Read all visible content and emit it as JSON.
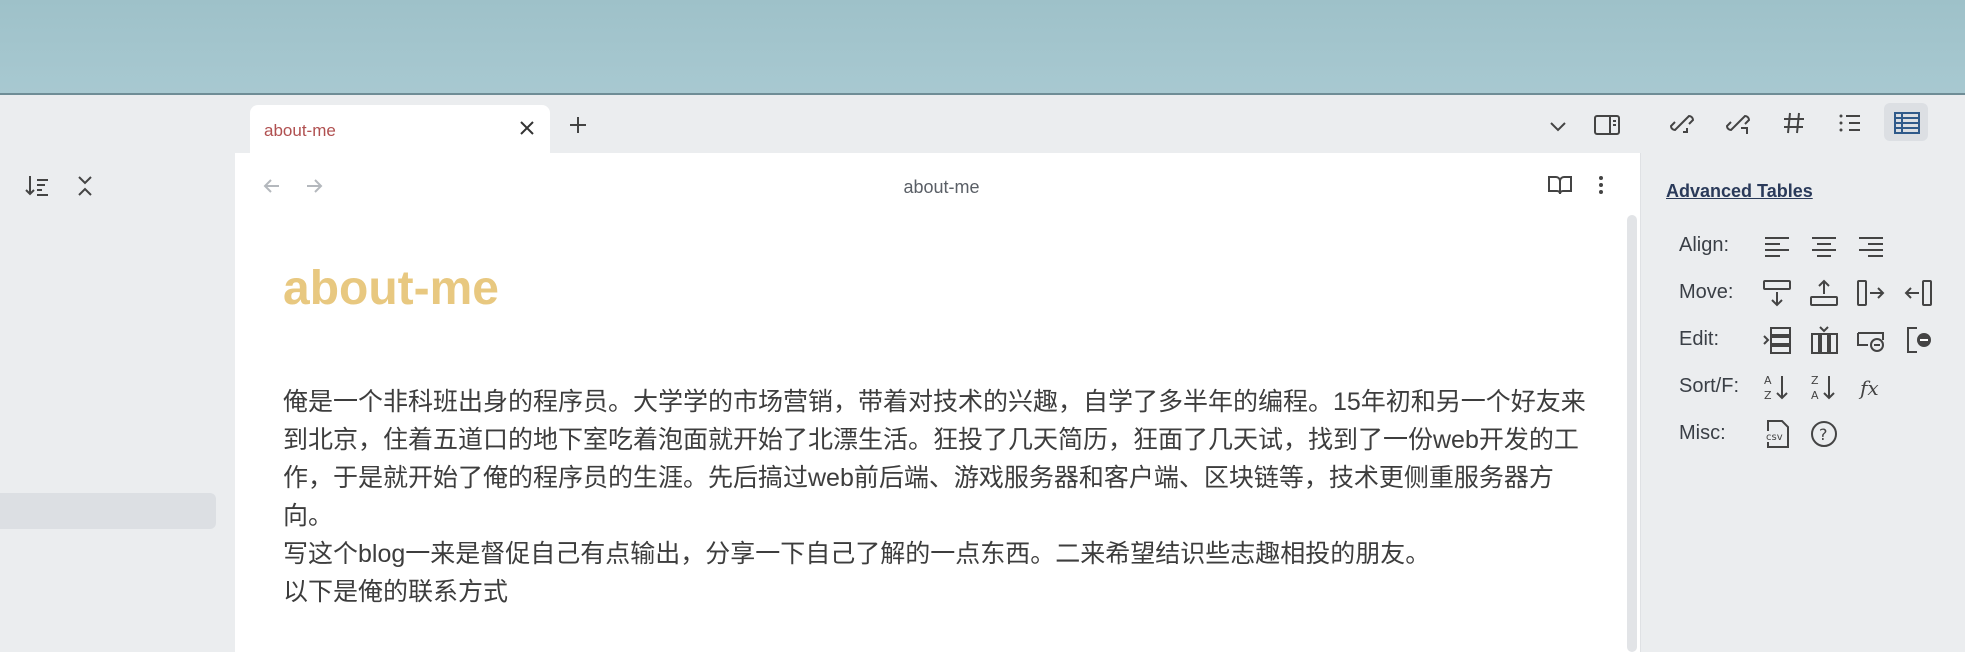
{
  "tab": {
    "title": "about-me"
  },
  "editor": {
    "view_title": "about-me",
    "heading": "about-me",
    "paragraphs": [
      "俺是一个非科班出身的程序员。大学学的市场营销，带着对技术的兴趣，自学了多半年的编程。15年初和另一个好友来到北京，住着五道口的地下室吃着泡面就开始了北漂生活。狂投了几天简历，狂面了几天试，找到了一份web开发的工作，于是就开始了俺的程序员的生涯。先后搞过web前后端、游戏服务器和客户端、区块链等，技术更侧重服务器方向。",
      "写这个blog一来是督促自己有点输出，分享一下自己了解的一点东西。二来希望结识些志趣相投的朋友。",
      "以下是俺的联系方式"
    ]
  },
  "right_toolbar": {
    "icons": [
      "backlinks-icon",
      "outgoing-links-icon",
      "tags-icon",
      "outline-icon",
      "advanced-tables-icon"
    ],
    "active": "advanced-tables-icon"
  },
  "panel": {
    "title": "Advanced Tables",
    "rows": [
      {
        "label": "Align:",
        "icons": [
          "align-left-icon",
          "align-center-icon",
          "align-right-icon"
        ]
      },
      {
        "label": "Move:",
        "icons": [
          "move-row-down-icon",
          "move-row-up-icon",
          "move-column-right-icon",
          "move-column-left-icon"
        ]
      },
      {
        "label": "Edit:",
        "icons": [
          "insert-row-icon",
          "insert-column-icon",
          "delete-row-icon",
          "delete-column-icon"
        ]
      },
      {
        "label": "Sort/F:",
        "icons": [
          "sort-ascending-icon",
          "sort-descending-icon",
          "formula-icon"
        ]
      },
      {
        "label": "Misc:",
        "icons": [
          "export-csv-icon",
          "help-icon"
        ]
      }
    ],
    "csv_label": "csv",
    "formula_label": "fx"
  }
}
